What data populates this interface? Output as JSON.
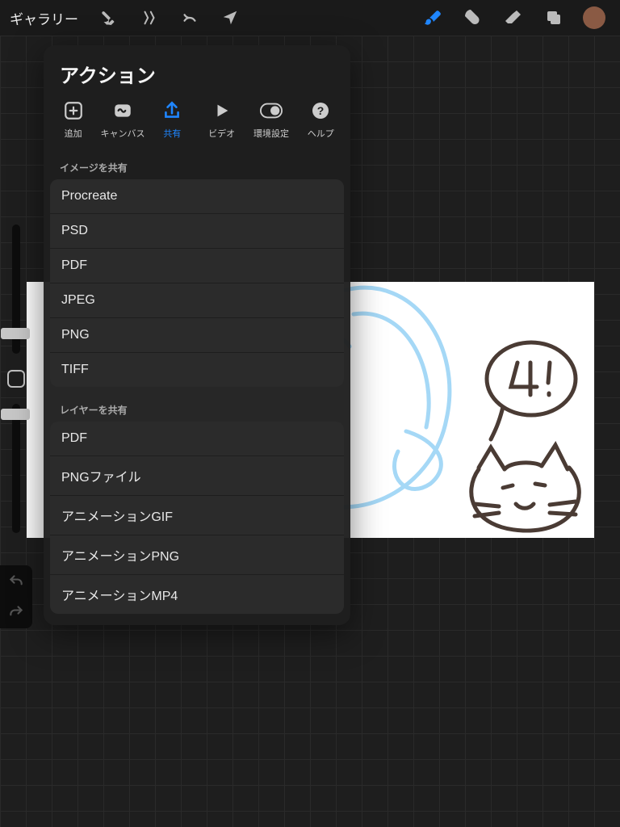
{
  "topbar": {
    "gallery_label": "ギャラリー"
  },
  "color_chip": "#8a5a44",
  "popover": {
    "title": "アクション",
    "tabs": [
      {
        "id": "add",
        "label": "追加"
      },
      {
        "id": "canvas",
        "label": "キャンバス"
      },
      {
        "id": "share",
        "label": "共有"
      },
      {
        "id": "video",
        "label": "ビデオ"
      },
      {
        "id": "prefs",
        "label": "環境設定"
      },
      {
        "id": "help",
        "label": "ヘルプ"
      }
    ],
    "active_tab": "share",
    "sections": [
      {
        "heading": "イメージを共有",
        "items": [
          "Procreate",
          "PSD",
          "PDF",
          "JPEG",
          "PNG",
          "TIFF"
        ]
      },
      {
        "heading": "レイヤーを共有",
        "items": [
          "PDF",
          "PNGファイル",
          "アニメーションGIF",
          "アニメーションPNG",
          "アニメーションMP4"
        ]
      }
    ]
  }
}
